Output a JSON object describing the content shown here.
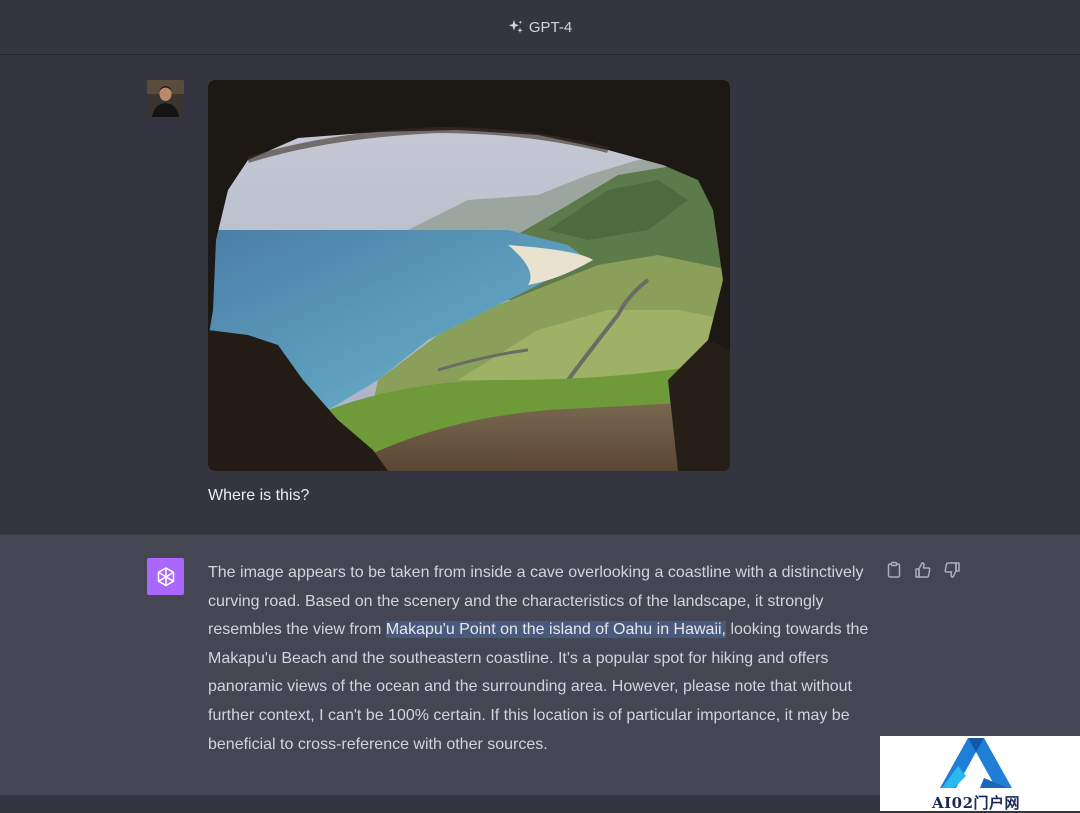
{
  "header": {
    "model_label": "GPT-4",
    "icon": "sparkle-icon"
  },
  "user_message": {
    "avatar": "user-avatar",
    "image": "cave-coastline-photo",
    "text": "Where is this?"
  },
  "assistant_message": {
    "avatar": "chatgpt-logo-icon",
    "answer_part1": "The image appears to be taken from inside a cave overlooking a coastline with a distinctively curving road. Based on the scenery and the characteristics of the landscape, it strongly resembles the view from ",
    "answer_highlight": "Makapu'u Point on the island of Oahu in Hawaii,",
    "answer_part2": " looking towards the Makapu'u Beach and the southeastern coastline. It's a popular spot for hiking and offers panoramic views of the ocean and the surrounding area. However, please note that without further context, I can't be 100% certain. If this location is of particular importance, it may be beneficial to cross-reference with other sources.",
    "actions": [
      "copy-icon",
      "thumbs-up-icon",
      "thumbs-down-icon"
    ]
  },
  "watermark": {
    "text": "AI02门户网"
  },
  "colors": {
    "background": "#343541",
    "assistant_background": "#444654",
    "gpt_avatar": "#ab68ff",
    "highlight": "#4a5a7d"
  }
}
